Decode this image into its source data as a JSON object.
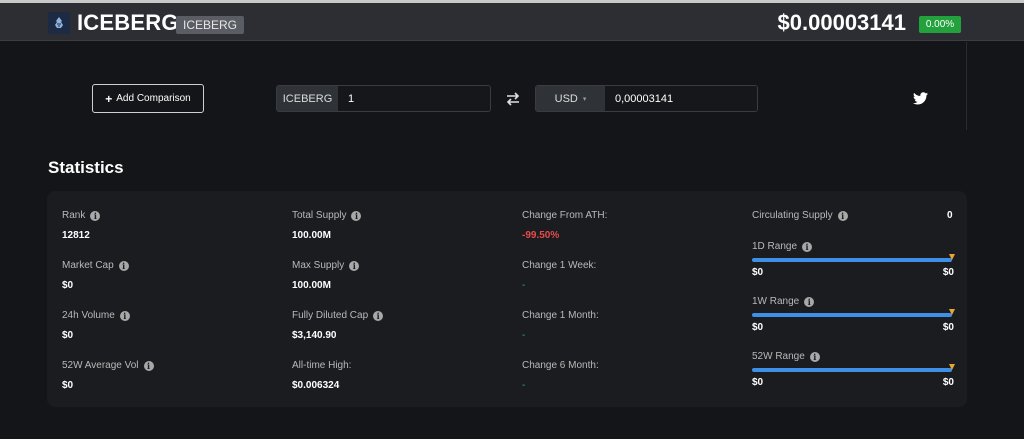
{
  "header": {
    "name": "ICEBERG",
    "symbol": "ICEBERG",
    "price": "$0.00003141",
    "change": "0.00%"
  },
  "toolbar": {
    "add_comparison": "Add Comparison"
  },
  "converter": {
    "from_label": "ICEBERG",
    "from_value": "1",
    "to_currency": "USD",
    "to_value": "0,00003141"
  },
  "stats": {
    "title": "Statistics",
    "col1": [
      {
        "label": "Rank",
        "value": "12812"
      },
      {
        "label": "Market Cap",
        "value": "$0"
      },
      {
        "label": "24h Volume",
        "value": "$0"
      },
      {
        "label": "52W Average Vol",
        "value": "$0"
      }
    ],
    "col2": [
      {
        "label": "Total Supply",
        "value": "100.00M"
      },
      {
        "label": "Max Supply",
        "value": "100.00M"
      },
      {
        "label": "Fully Diluted Cap",
        "value": "$3,140.90"
      },
      {
        "label": "All-time High:",
        "value": "$0.006324"
      }
    ],
    "col3": [
      {
        "label": "Change From ATH:",
        "value": "-99.50%"
      },
      {
        "label": "Change 1 Week:",
        "value": "-"
      },
      {
        "label": "Change 1 Month:",
        "value": "-"
      },
      {
        "label": "Change 6 Month:",
        "value": "-"
      }
    ],
    "circulating": {
      "label": "Circulating Supply",
      "value": "0"
    },
    "ranges": [
      {
        "label": "1D Range",
        "low": "$0",
        "high": "$0",
        "position": 1.0
      },
      {
        "label": "1W Range",
        "low": "$0",
        "high": "$0",
        "position": 1.0
      },
      {
        "label": "52W Range",
        "low": "$0",
        "high": "$0",
        "position": 1.0
      }
    ]
  },
  "colors": {
    "accent_green": "#23a13d",
    "negative_red": "#e84b4b",
    "range_blue": "#3e8fe6",
    "marker_orange": "#e7a533"
  }
}
